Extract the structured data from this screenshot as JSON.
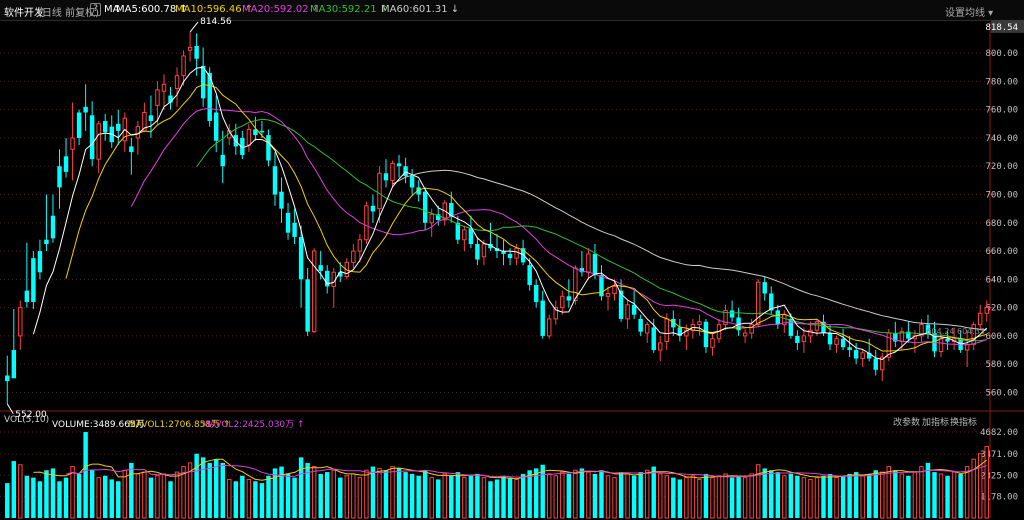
{
  "header": {
    "title": "软件开发",
    "subtitle": "(日线 前复权)",
    "help": "?",
    "ma_label": "MA",
    "ma_items": [
      {
        "label": "MA5:600.78",
        "color": "#ffffff"
      },
      {
        "label": "MA10:596.46",
        "color": "#f0d000"
      },
      {
        "label": "MA20:592.02",
        "color": "#e040e0"
      },
      {
        "label": "MA30:592.21",
        "color": "#30c030"
      },
      {
        "label": "MA60:601.31",
        "color": "#cccccc"
      }
    ],
    "settings": "设置均线"
  },
  "volume_header": {
    "label": "VOL(5,10)",
    "items": [
      {
        "label": "VOLUME:3489.665万",
        "color": "#ffffff"
      },
      {
        "label": "MAVOL1:2706.858万",
        "color": "#f0d000"
      },
      {
        "label": "MAVOL2:2425.030万",
        "color": "#e040e0"
      }
    ],
    "buttons": [
      "改参数",
      "加指标",
      "换指标"
    ]
  },
  "colors": {
    "up": "#ff4040",
    "down": "#00ffff",
    "ma5": "#ffffff",
    "ma10": "#f0d000",
    "ma20": "#e040e0",
    "ma30": "#30c030",
    "ma60": "#cccccc",
    "grid": "#5a1a1a"
  },
  "chart_data": {
    "type": "candlestick",
    "price_axis": {
      "ticks": [
        560,
        580,
        600,
        620,
        640,
        660,
        680,
        700,
        720,
        740,
        760,
        780,
        800
      ],
      "tick_labels": [
        "560.00",
        "580.00",
        "600.00",
        "620.00",
        "640.00",
        "660.00",
        "680.00",
        "700.00",
        "720.00",
        "740.00",
        "760.00",
        "780.00",
        "800.00"
      ],
      "top_label": "818.54",
      "range": [
        549,
        822
      ]
    },
    "volume_axis": {
      "ticks": [
        1178,
        2325,
        3471,
        4682
      ],
      "tick_labels": [
        "1178.00",
        "2325.00",
        "3471.00",
        "4682.00"
      ],
      "range": [
        0,
        4900
      ]
    },
    "annotations": {
      "max_label": "814.56",
      "min_label": "552.00",
      "readout": "604.24 604.33"
    },
    "candles": [
      [
        572,
        586,
        552,
        568,
        1900
      ],
      [
        590,
        619,
        583,
        570,
        3100
      ],
      [
        600,
        625,
        590,
        620,
        2900
      ],
      [
        632,
        666,
        620,
        624,
        2300
      ],
      [
        655,
        660,
        619,
        624,
        2200
      ],
      [
        660,
        668,
        640,
        645,
        2000
      ],
      [
        668,
        700,
        660,
        665,
        2600
      ],
      [
        685,
        700,
        666,
        669,
        2700
      ],
      [
        720,
        732,
        690,
        705,
        2000
      ],
      [
        727,
        740,
        712,
        716,
        2200
      ],
      [
        732,
        765,
        710,
        740,
        2800
      ],
      [
        758,
        760,
        735,
        740,
        2400
      ],
      [
        762,
        778,
        745,
        758,
        4680
      ],
      [
        756,
        766,
        720,
        725,
        2600
      ],
      [
        725,
        752,
        715,
        750,
        2200
      ],
      [
        752,
        757,
        738,
        744,
        2300
      ],
      [
        748,
        756,
        733,
        737,
        2100
      ],
      [
        750,
        760,
        735,
        745,
        2000
      ],
      [
        738,
        758,
        730,
        754,
        2600
      ],
      [
        734,
        740,
        714,
        730,
        3000
      ],
      [
        740,
        752,
        728,
        748,
        2400
      ],
      [
        745,
        765,
        744,
        758,
        2500
      ],
      [
        756,
        770,
        740,
        752,
        2200
      ],
      [
        763,
        780,
        750,
        774,
        2300
      ],
      [
        773,
        785,
        760,
        778,
        2400
      ],
      [
        770,
        776,
        760,
        765,
        2000
      ],
      [
        775,
        790,
        762,
        784,
        2500
      ],
      [
        784,
        802,
        777,
        798,
        2800
      ],
      [
        802,
        815,
        794,
        804,
        3000
      ],
      [
        805,
        814,
        784,
        796,
        3500
      ],
      [
        791,
        804,
        762,
        768,
        3300
      ],
      [
        786,
        790,
        748,
        752,
        3000
      ],
      [
        758,
        770,
        730,
        738,
        3200
      ],
      [
        728,
        745,
        708,
        720,
        3000
      ],
      [
        740,
        750,
        735,
        745,
        2100
      ],
      [
        742,
        750,
        728,
        734,
        2000
      ],
      [
        740,
        745,
        725,
        728,
        2300
      ],
      [
        735,
        750,
        730,
        746,
        2100
      ],
      [
        746,
        755,
        738,
        742,
        2000
      ],
      [
        745,
        752,
        740,
        744,
        1900
      ],
      [
        742,
        746,
        720,
        724,
        2300
      ],
      [
        720,
        730,
        692,
        700,
        2700
      ],
      [
        702,
        712,
        680,
        690,
        2800
      ],
      [
        687,
        694,
        668,
        673,
        2400
      ],
      [
        680,
        690,
        665,
        670,
        2200
      ],
      [
        670,
        678,
        620,
        640,
        3300
      ],
      [
        640,
        648,
        600,
        603,
        3000
      ],
      [
        603,
        662,
        602,
        660,
        2800
      ],
      [
        650,
        660,
        640,
        646,
        2400
      ],
      [
        646,
        650,
        630,
        635,
        2500
      ],
      [
        635,
        648,
        620,
        645,
        2600
      ],
      [
        645,
        652,
        638,
        642,
        2200
      ],
      [
        642,
        655,
        640,
        652,
        2300
      ],
      [
        652,
        665,
        648,
        660,
        2400
      ],
      [
        660,
        672,
        652,
        668,
        2200
      ],
      [
        668,
        695,
        665,
        692,
        2600
      ],
      [
        692,
        700,
        680,
        688,
        2800
      ],
      [
        690,
        720,
        680,
        715,
        2700
      ],
      [
        715,
        725,
        705,
        710,
        2600
      ],
      [
        710,
        724,
        705,
        722,
        2800
      ],
      [
        722,
        728,
        712,
        720,
        2700
      ],
      [
        720,
        726,
        708,
        713,
        2500
      ],
      [
        713,
        718,
        700,
        705,
        2400
      ],
      [
        705,
        710,
        695,
        700,
        2300
      ],
      [
        702,
        705,
        675,
        680,
        2600
      ],
      [
        680,
        690,
        670,
        686,
        2200
      ],
      [
        686,
        692,
        678,
        682,
        2100
      ],
      [
        682,
        696,
        678,
        694,
        2400
      ],
      [
        694,
        702,
        680,
        684,
        2300
      ],
      [
        680,
        685,
        665,
        668,
        2500
      ],
      [
        668,
        678,
        660,
        675,
        2200
      ],
      [
        676,
        685,
        662,
        665,
        2300
      ],
      [
        665,
        670,
        650,
        654,
        2400
      ],
      [
        656,
        668,
        650,
        665,
        2200
      ],
      [
        665,
        680,
        660,
        662,
        2000
      ],
      [
        662,
        672,
        655,
        660,
        2100
      ],
      [
        660,
        668,
        650,
        658,
        2300
      ],
      [
        658,
        662,
        650,
        655,
        2200
      ],
      [
        655,
        665,
        650,
        662,
        2100
      ],
      [
        662,
        668,
        650,
        652,
        2400
      ],
      [
        650,
        655,
        632,
        636,
        2600
      ],
      [
        636,
        640,
        620,
        624,
        2700
      ],
      [
        625,
        632,
        598,
        600,
        2900
      ],
      [
        600,
        615,
        598,
        612,
        2400
      ],
      [
        612,
        625,
        608,
        620,
        2300
      ],
      [
        620,
        632,
        615,
        628,
        2500
      ],
      [
        628,
        640,
        620,
        625,
        2400
      ],
      [
        625,
        650,
        622,
        648,
        2600
      ],
      [
        648,
        660,
        642,
        645,
        2700
      ],
      [
        645,
        662,
        640,
        658,
        2500
      ],
      [
        658,
        665,
        640,
        643,
        2400
      ],
      [
        643,
        650,
        625,
        628,
        2600
      ],
      [
        628,
        635,
        618,
        630,
        2300
      ],
      [
        630,
        640,
        625,
        635,
        2200
      ],
      [
        632,
        640,
        610,
        612,
        2500
      ],
      [
        612,
        625,
        605,
        622,
        2400
      ],
      [
        622,
        632,
        612,
        615,
        2300
      ],
      [
        612,
        615,
        600,
        603,
        2500
      ],
      [
        602,
        610,
        595,
        608,
        2600
      ],
      [
        606,
        612,
        588,
        590,
        2800
      ],
      [
        590,
        600,
        582,
        595,
        2400
      ],
      [
        596,
        616,
        590,
        612,
        2300
      ],
      [
        612,
        618,
        600,
        606,
        2200
      ],
      [
        606,
        612,
        596,
        600,
        2100
      ],
      [
        600,
        608,
        590,
        604,
        2200
      ],
      [
        604,
        612,
        598,
        608,
        2300
      ],
      [
        608,
        615,
        600,
        610,
        2100
      ],
      [
        610,
        612,
        588,
        592,
        2400
      ],
      [
        592,
        602,
        586,
        598,
        2200
      ],
      [
        598,
        612,
        595,
        608,
        2300
      ],
      [
        608,
        622,
        604,
        618,
        2400
      ],
      [
        618,
        625,
        610,
        613,
        2200
      ],
      [
        613,
        620,
        600,
        604,
        2300
      ],
      [
        600,
        605,
        595,
        602,
        2200
      ],
      [
        602,
        612,
        598,
        608,
        2400
      ],
      [
        608,
        640,
        606,
        638,
        2900
      ],
      [
        638,
        642,
        625,
        630,
        2700
      ],
      [
        630,
        635,
        615,
        618,
        2600
      ],
      [
        618,
        622,
        605,
        608,
        2500
      ],
      [
        608,
        618,
        602,
        615,
        2300
      ],
      [
        612,
        616,
        598,
        600,
        2400
      ],
      [
        600,
        604,
        590,
        595,
        2300
      ],
      [
        596,
        606,
        588,
        600,
        2200
      ],
      [
        600,
        610,
        595,
        604,
        2100
      ],
      [
        604,
        612,
        600,
        610,
        2200
      ],
      [
        610,
        615,
        600,
        602,
        2300
      ],
      [
        602,
        608,
        590,
        594,
        2400
      ],
      [
        594,
        600,
        588,
        598,
        2200
      ],
      [
        598,
        605,
        590,
        592,
        2300
      ],
      [
        592,
        600,
        585,
        590,
        2400
      ],
      [
        590,
        595,
        580,
        584,
        2500
      ],
      [
        584,
        590,
        578,
        588,
        2300
      ],
      [
        588,
        598,
        582,
        584,
        2400
      ],
      [
        584,
        590,
        572,
        576,
        2600
      ],
      [
        576,
        588,
        568,
        585,
        2500
      ],
      [
        585,
        605,
        582,
        602,
        2800
      ],
      [
        602,
        610,
        592,
        596,
        2600
      ],
      [
        596,
        606,
        590,
        603,
        2400
      ],
      [
        603,
        610,
        595,
        598,
        2300
      ],
      [
        598,
        604,
        588,
        600,
        2500
      ],
      [
        600,
        612,
        596,
        608,
        2800
      ],
      [
        608,
        615,
        598,
        602,
        3000
      ],
      [
        602,
        610,
        585,
        589,
        2500
      ],
      [
        589,
        602,
        585,
        598,
        2400
      ],
      [
        598,
        604,
        590,
        596,
        2300
      ],
      [
        596,
        606,
        590,
        598,
        2500
      ],
      [
        598,
        604,
        588,
        590,
        2400
      ],
      [
        590,
        604,
        578,
        594,
        2800
      ],
      [
        594,
        610,
        590,
        608,
        3200
      ],
      [
        608,
        622,
        604,
        616,
        3500
      ],
      [
        616,
        625,
        610,
        620,
        3900
      ]
    ]
  }
}
